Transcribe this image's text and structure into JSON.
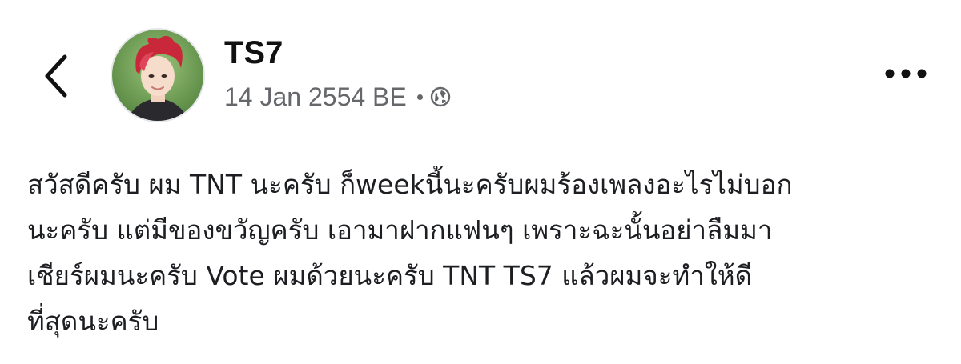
{
  "header": {
    "back_icon": "chevron-left-icon",
    "more_icon": "more-horizontal-icon"
  },
  "post": {
    "author": "TS7",
    "date": "14 Jan 2554 BE",
    "separator": "·",
    "privacy_icon": "globe-icon",
    "text_lines": [
      "สวัสดีครับ ผม TNT นะครับ ก็weekนี้นะครับผมร้องเพลงอะไรไม่บอก",
      "นะครับ แต่มีของขวัญครับ เอามาฝากแฟนๆ เพราะฉะนั้นอย่าลืมมา",
      "เชียร์ผมนะครับ Vote ผมด้วยนะครับ TNT TS7 แล้วผมจะทำให้ดี",
      "ที่สุดนะครับ"
    ]
  },
  "colors": {
    "text": "#1c1e21",
    "secondary": "#65676b",
    "background": "#ffffff"
  }
}
